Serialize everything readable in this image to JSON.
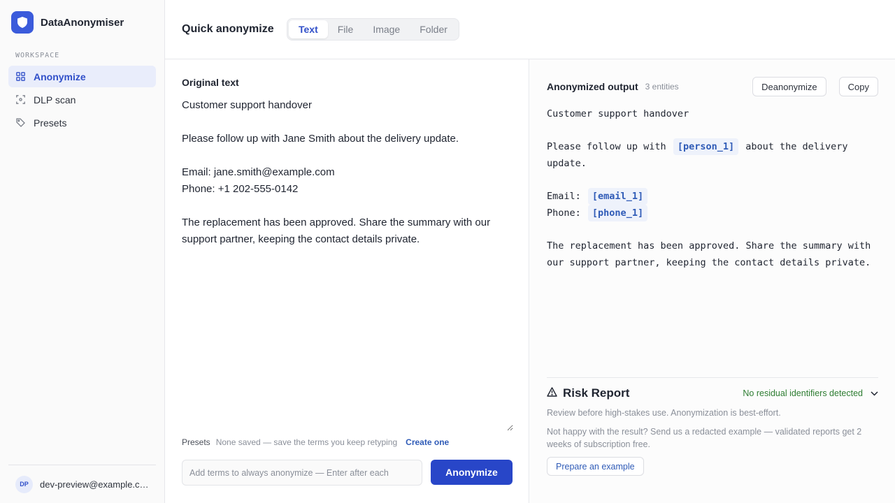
{
  "app": {
    "name": "DataAnonymiser",
    "accent": "#3b5bdb"
  },
  "sidebar": {
    "section_label": "WORKSPACE",
    "items": [
      {
        "label": "Anonymize",
        "icon": "grid-icon",
        "active": true
      },
      {
        "label": "DLP scan",
        "icon": "scan-icon",
        "active": false
      },
      {
        "label": "Presets",
        "icon": "tag-icon",
        "active": false
      }
    ],
    "user": {
      "initials": "DP",
      "email": "dev-preview@example.com"
    }
  },
  "header": {
    "title": "Quick anonymize",
    "tabs": [
      {
        "label": "Text",
        "active": true
      },
      {
        "label": "File",
        "active": false
      },
      {
        "label": "Image",
        "active": false
      },
      {
        "label": "Folder",
        "active": false
      }
    ]
  },
  "input": {
    "title": "Original text",
    "text": "Customer support handover\n\nPlease follow up with Jane Smith about the delivery update.\n\nEmail: jane.smith@example.com\nPhone: +1 202-555-0142\n\nThe replacement has been approved. Share the summary with our support partner, keeping the contact details private.",
    "presets_label": "Presets",
    "presets_note": "None saved — save the terms you keep retyping",
    "presets_link": "Create one",
    "terms_placeholder": "Add terms to always anonymize — Enter after each",
    "anonymize_label": "Anonymize"
  },
  "output": {
    "title": "Anonymized output",
    "count": "3 entities",
    "deanonymize_label": "Deanonymize",
    "copy_label": "Copy",
    "line1": "Customer support handover",
    "line2_pre": "Please follow up with",
    "token_person": "[person_1]",
    "line2_post": "about the delivery update.",
    "email_label": "Email:",
    "token_email": "[email_1]",
    "phone_label": "Phone:",
    "token_phone": "[phone_1]",
    "line_final": "The replacement has been approved. Share the summary with our support partner, keeping the contact details private."
  },
  "risk": {
    "title": "Risk Report",
    "status": "No residual identifiers detected",
    "status_color": "#2e7d32",
    "note": "Review before high-stakes use. Anonymization is best-effort.",
    "feedback": "Not happy with the result? Send us a redacted example — validated reports get 2 weeks of subscription free.",
    "prepare_label": "Prepare an example"
  }
}
